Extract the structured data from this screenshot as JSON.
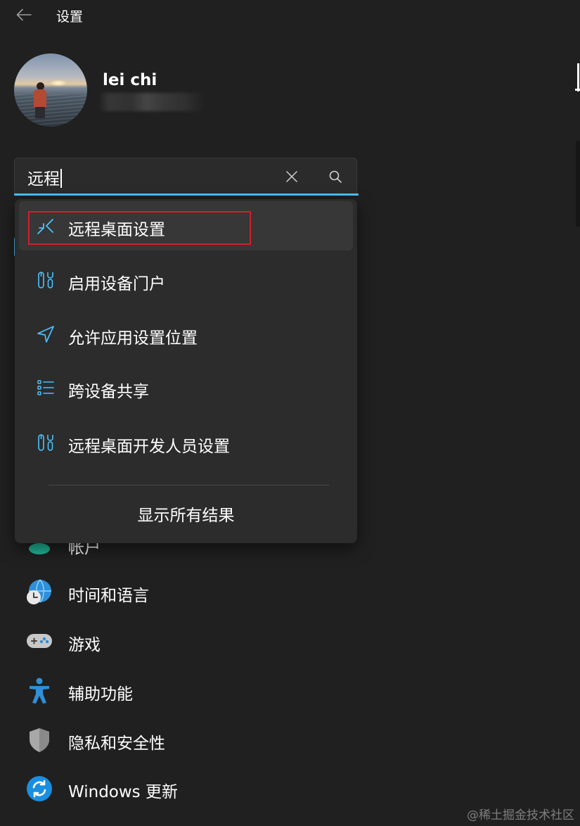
{
  "window": {
    "title": "设置"
  },
  "profile": {
    "name": "lei chi"
  },
  "search": {
    "value": "远程"
  },
  "results": [
    {
      "label": "远程桌面设置",
      "icon": "remote-desktop-icon"
    },
    {
      "label": "启用设备门户",
      "icon": "developer-tools-icon"
    },
    {
      "label": "允许应用设置位置",
      "icon": "location-arrow-icon"
    },
    {
      "label": "跨设备共享",
      "icon": "list-icon"
    },
    {
      "label": "远程桌面开发人员设置",
      "icon": "developer-tools-icon"
    }
  ],
  "show_all_label": "显示所有结果",
  "nav": {
    "accounts_label": "帐户",
    "items": [
      {
        "label": "时间和语言",
        "icon": "time-language-icon"
      },
      {
        "label": "游戏",
        "icon": "gamepad-icon"
      },
      {
        "label": "辅助功能",
        "icon": "accessibility-icon"
      },
      {
        "label": "隐私和安全性",
        "icon": "shield-icon"
      },
      {
        "label": "Windows 更新",
        "icon": "windows-update-icon"
      }
    ]
  },
  "watermark": "@稀土掘金技术社区",
  "colors": {
    "background": "#202020",
    "accent": "#4cc2ff",
    "highlight_border": "#d11f2b"
  }
}
